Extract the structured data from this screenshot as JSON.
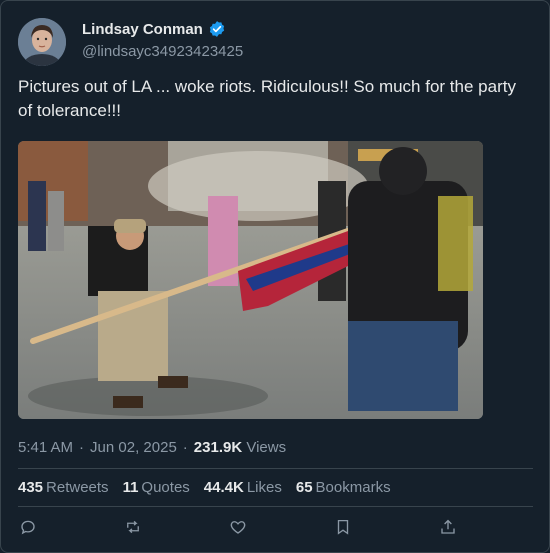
{
  "user": {
    "name": "Lindsay Conman",
    "handle": "@lindsayc34923423425",
    "verified": true
  },
  "tweet": {
    "text": "Pictures out of LA ... woke riots. Ridiculous!! So much for the party of tolerance!!!"
  },
  "meta": {
    "time": "5:41 AM",
    "date": "Jun 02, 2025",
    "separator_dot": "·",
    "date_separator": "·",
    "views_count": "231.9K",
    "views_label": "Views"
  },
  "stats": {
    "retweets_count": "435",
    "retweets_label": "Retweets",
    "quotes_count": "11",
    "quotes_label": "Quotes",
    "likes_count": "44.4K",
    "likes_label": "Likes",
    "bookmarks_count": "65",
    "bookmarks_label": "Bookmarks"
  },
  "icons": {
    "reply": "reply-icon",
    "retweet": "retweet-icon",
    "like": "heart-icon",
    "bookmark": "bookmark-icon",
    "share": "share-icon",
    "verified": "verified-badge-icon"
  },
  "colors": {
    "background": "#15202b",
    "text": "#e7e9ea",
    "muted": "#8b98a5",
    "verified": "#1d9bf0",
    "border": "#38444d"
  }
}
